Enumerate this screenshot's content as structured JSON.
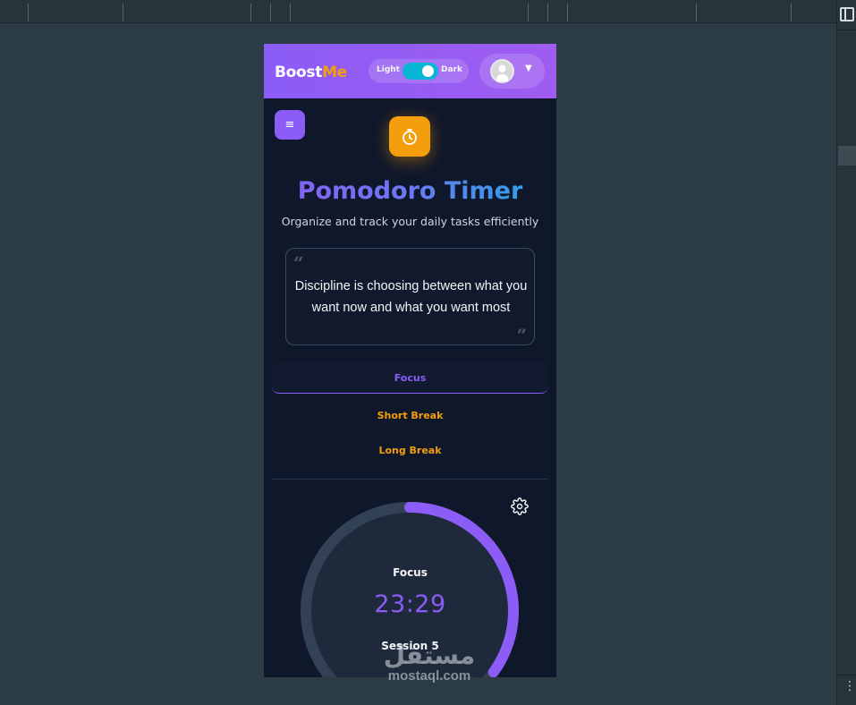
{
  "app": {
    "brand_primary": "Boost",
    "brand_accent": "Me",
    "theme": {
      "light_label": "Light",
      "dark_label": "Dark",
      "dark_enabled": true
    }
  },
  "header": {
    "title": "Pomodoro Timer",
    "subtitle": "Organize and track your daily tasks efficiently"
  },
  "quote": {
    "text": "Discipline is choosing between what you want now and what you want most"
  },
  "modes": [
    {
      "label": "Focus",
      "active": true
    },
    {
      "label": "Short Break",
      "active": false
    },
    {
      "label": "Long Break",
      "active": false
    }
  ],
  "timer": {
    "label": "Focus",
    "time": "23:29",
    "session": "Session 5",
    "progress_fraction": 0.35
  },
  "watermark": {
    "arabic": "مستقل",
    "latin": "mostaql.com"
  },
  "colors": {
    "accent": "#8b5cf6",
    "secondary": "#f59e0b",
    "toggle": "#06b6d4",
    "background": "#0f172a"
  },
  "icons": [
    "menu-icon",
    "timer-icon",
    "gear-icon",
    "chevron-down-icon",
    "panel-toggle-icon",
    "more-icon"
  ]
}
